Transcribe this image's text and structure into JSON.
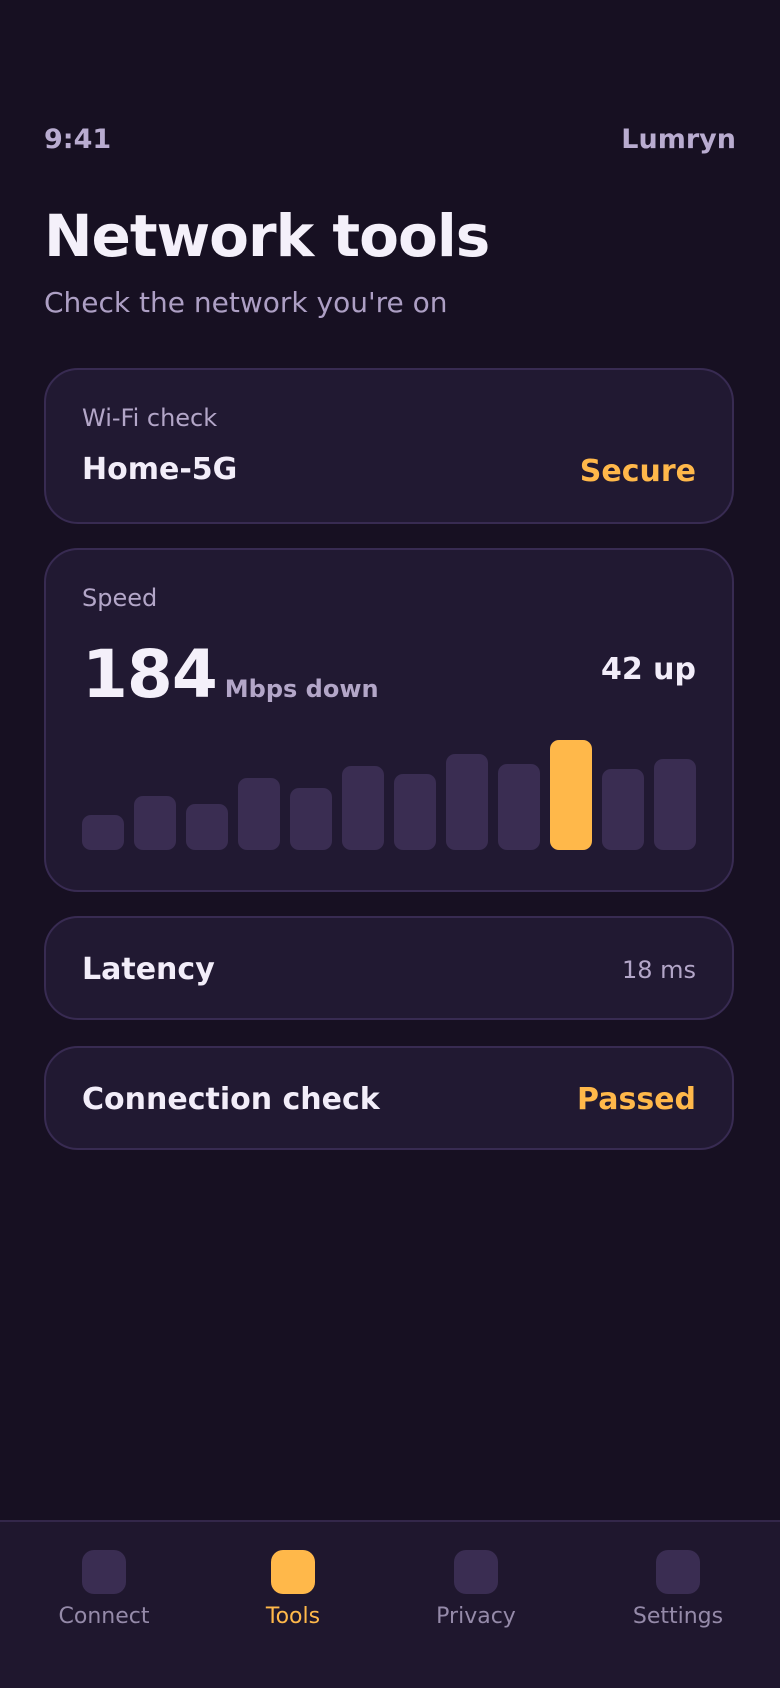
{
  "status_bar": {
    "time": "9:41",
    "brand": "Lumryn"
  },
  "header": {
    "title": "Network tools",
    "subtitle": "Check the network you're on"
  },
  "wifi_card": {
    "label": "Wi-Fi check",
    "network_name": "Home-5G",
    "status": "Secure"
  },
  "speed_card": {
    "label": "Speed",
    "down_value": "184",
    "down_unit": "Mbps down",
    "up": "42 up",
    "history_levels": [
      0.32,
      0.49,
      0.42,
      0.65,
      0.56,
      0.76,
      0.69,
      0.87,
      0.78,
      1.0,
      0.74,
      0.83
    ],
    "highlight_index": 9
  },
  "latency_card": {
    "title": "Latency",
    "value": "18 ms"
  },
  "connection_card": {
    "title": "Connection check",
    "value": "Passed"
  },
  "tabbar": {
    "items": [
      {
        "label": "Connect",
        "icon": "connect-icon",
        "active": false
      },
      {
        "label": "Tools",
        "icon": "tools-icon",
        "active": true
      },
      {
        "label": "Privacy",
        "icon": "privacy-icon",
        "active": false
      },
      {
        "label": "Settings",
        "icon": "settings-icon",
        "active": false
      }
    ]
  },
  "colors": {
    "background": "#171022",
    "card": "#211932",
    "accent": "#ffb84a",
    "bar": "#3a2d52"
  }
}
